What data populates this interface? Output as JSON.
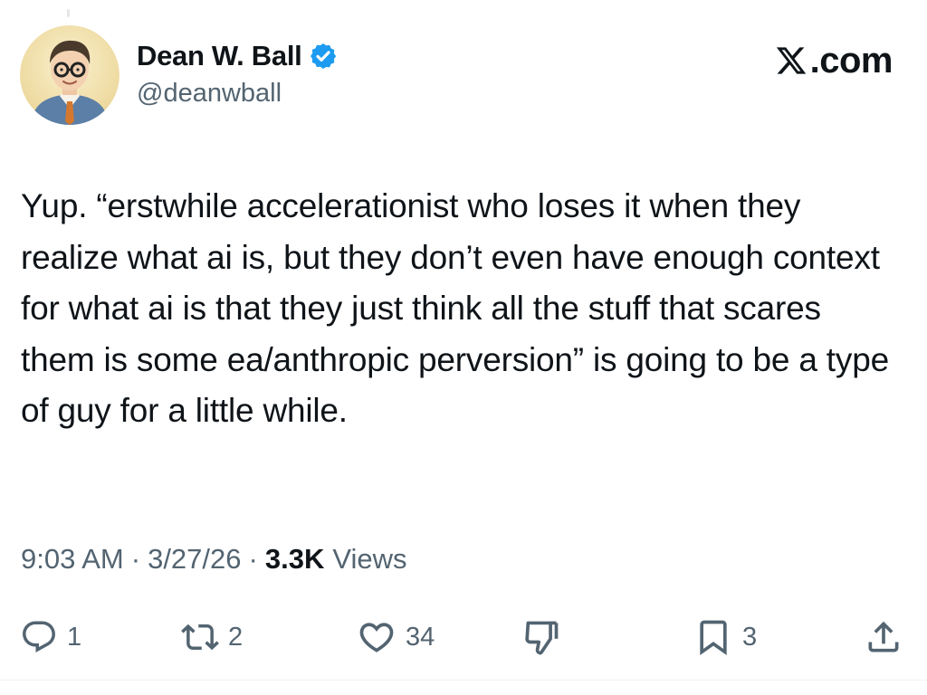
{
  "author": {
    "display_name": "Dean W. Ball",
    "handle": "@deanwball",
    "verified": true,
    "verified_color": "#1d9bf0"
  },
  "site": {
    "logo_text": ".com",
    "logo_icon": "x-logo-icon"
  },
  "tweet": {
    "text": "Yup. “erstwhile accelerationist who loses it when they realize what ai is, but they don’t even have enough context for what ai is that they just think all the stuff that scares them is some ea/anthropic perversion” is going to be a type of guy for a little while."
  },
  "meta": {
    "time": "9:03 AM",
    "separator": "·",
    "date": "3/27/26",
    "views_count": "3.3K",
    "views_label": "Views"
  },
  "actions": {
    "reply": {
      "icon": "reply-icon",
      "count": "1"
    },
    "repost": {
      "icon": "repost-icon",
      "count": "2"
    },
    "like": {
      "icon": "heart-icon",
      "count": "34"
    },
    "dislike": {
      "icon": "thumbs-down-icon"
    },
    "bookmark": {
      "icon": "bookmark-icon",
      "count": "3"
    },
    "share": {
      "icon": "share-icon"
    }
  },
  "colors": {
    "text_primary": "#0f1419",
    "text_secondary": "#536471",
    "accent": "#1d9bf0"
  }
}
